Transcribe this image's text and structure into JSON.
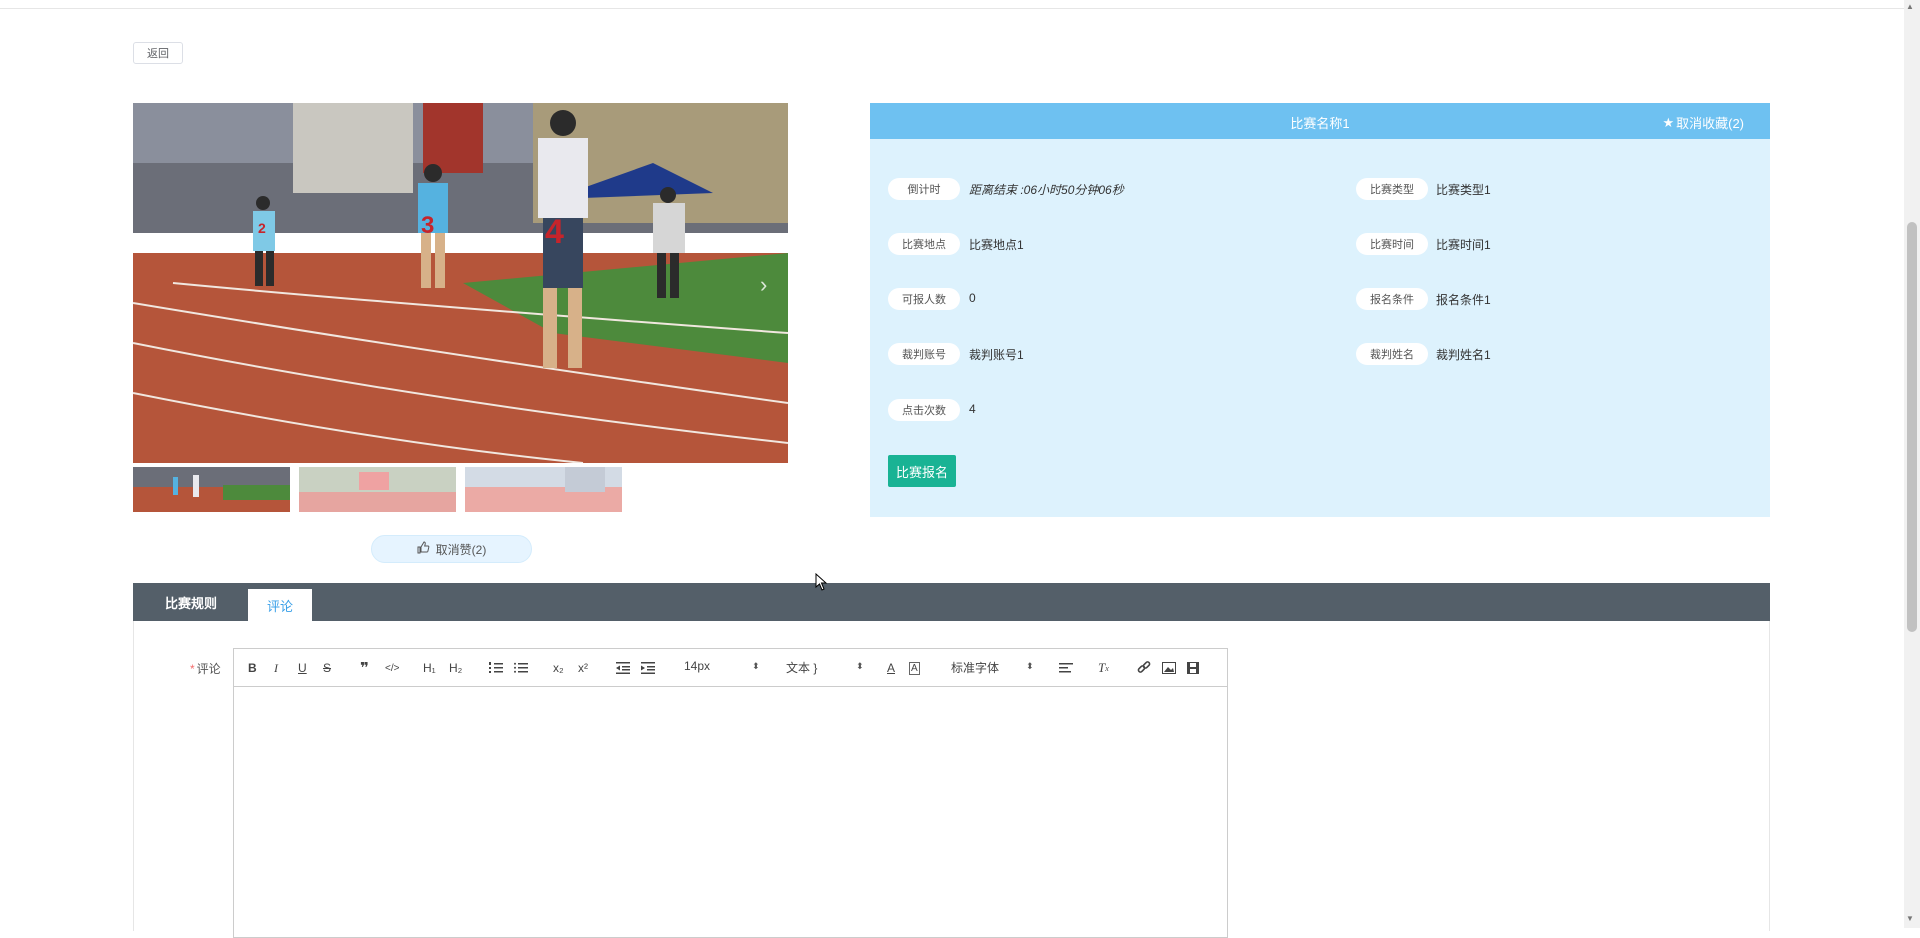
{
  "back_label": "返回",
  "competition": {
    "title": "比赛名称1",
    "favorite_label": "取消收藏(2)",
    "fields": {
      "countdown": {
        "label": "倒计时",
        "value": "距离结束 :06小时50分钟06秒"
      },
      "type": {
        "label": "比赛类型",
        "value": "比赛类型1"
      },
      "location": {
        "label": "比赛地点",
        "value": "比赛地点1"
      },
      "time": {
        "label": "比赛时间",
        "value": "比赛时间1"
      },
      "capacity": {
        "label": "可报人数",
        "value": "0"
      },
      "condition": {
        "label": "报名条件",
        "value": "报名条件1"
      },
      "referee_account": {
        "label": "裁判账号",
        "value": "裁判账号1"
      },
      "referee_name": {
        "label": "裁判姓名",
        "value": "裁判姓名1"
      },
      "clicks": {
        "label": "点击次数",
        "value": "4"
      }
    },
    "signup_label": "比赛报名"
  },
  "like_label": "取消赞(2)",
  "tabs": [
    {
      "label": "比赛规则",
      "active": false
    },
    {
      "label": "评论",
      "active": true
    }
  ],
  "comment": {
    "label": "评论",
    "required_mark": "*",
    "editor": {
      "bold": "B",
      "italic": "I",
      "underline": "U",
      "strike": "S",
      "h1": "H₁",
      "h2": "H₂",
      "sub": "x₂",
      "sup": "x²",
      "font_size": "14px",
      "header_select": "文本",
      "font_family": "标准字体"
    }
  },
  "colors": {
    "header_blue": "#6ec1f1",
    "panel_bg": "#ddf2fd",
    "signup_green": "#19b394",
    "tabs_bg": "#545f69",
    "active_tab_text": "#3aa0e8"
  }
}
